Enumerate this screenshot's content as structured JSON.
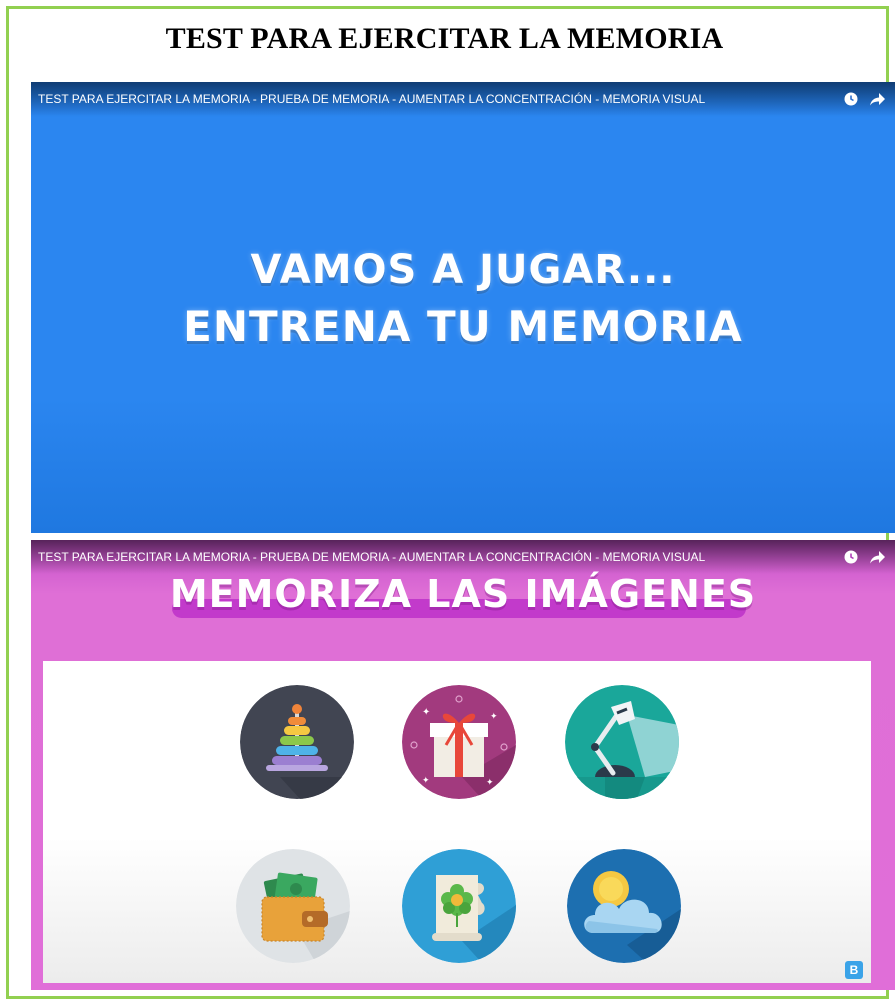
{
  "document": {
    "title": "TEST PARA EJERCITAR LA MEMORIA"
  },
  "video1": {
    "bar_title": "TEST PARA EJERCITAR LA MEMORIA - PRUEBA DE MEMORIA - AUMENTAR LA CONCENTRACIÓN - MEMORIA VISUAL",
    "line1": "VAMOS A JUGAR...",
    "line2": "ENTRENA TU MEMORIA",
    "icons": [
      "watch-later-icon",
      "share-icon"
    ],
    "background_color": "#2b86f0"
  },
  "video2": {
    "bar_title": "TEST PARA EJERCITAR LA MEMORIA - PRUEBA DE MEMORIA - AUMENTAR LA CONCENTRACIÓN - MEMORIA VISUAL",
    "banner": "MEMORIZA LAS IMÁGENES",
    "icons": [
      "watch-later-icon",
      "share-icon"
    ],
    "tiles": [
      "ring-stacker-toy-icon",
      "gift-box-icon",
      "desk-lamp-icon",
      "wallet-money-icon",
      "flower-scroll-icon",
      "sun-cloud-icon"
    ],
    "corner_badge": "B",
    "background_color": "#e06ed8"
  },
  "colors": {
    "frame_border": "#92d050"
  }
}
